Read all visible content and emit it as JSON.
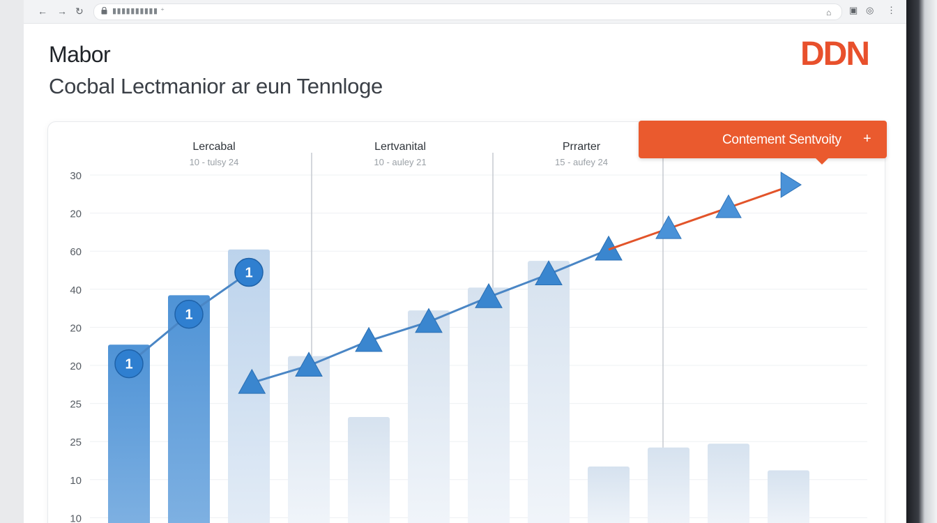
{
  "header": {
    "title": "Mabor",
    "subtitle": "Cocbal Lectmanior ar eun Tennloge",
    "brand": "DDN"
  },
  "tooltip": {
    "label": "Contement Sentvoity",
    "plus": "+"
  },
  "colors": {
    "brand": "#e8502c",
    "tooltip": "#ea5a2e",
    "bar_blue": "#5b9bd5",
    "bar_light": "#c8d8ea",
    "line_blue": "#4a86c5",
    "line_orange": "#e2542a"
  },
  "chart_data": {
    "type": "bar",
    "ytick_labels": [
      "30",
      "20",
      "60",
      "40",
      "20",
      "20",
      "25",
      "25",
      "10",
      "10"
    ],
    "column_headers": [
      {
        "label": "Lercabal",
        "sub": "10 - tulsy 24"
      },
      {
        "label": "Lertvanital",
        "sub": "10 - auley 21"
      },
      {
        "label": "Prrarter",
        "sub": "15 - aufey 24"
      }
    ],
    "bars": [
      {
        "level": 4.5,
        "tone": "dark"
      },
      {
        "level": 5.8,
        "tone": "dark"
      },
      {
        "level": 7.0,
        "tone": "light"
      },
      {
        "level": 4.2,
        "tone": "fade"
      },
      {
        "level": 2.6,
        "tone": "fade"
      },
      {
        "level": 5.4,
        "tone": "fade"
      },
      {
        "level": 6.0,
        "tone": "fade"
      },
      {
        "level": 6.7,
        "tone": "fade"
      },
      {
        "level": 1.3,
        "tone": "fade"
      },
      {
        "level": 1.8,
        "tone": "fade"
      },
      {
        "level": 1.9,
        "tone": "fade"
      },
      {
        "level": 1.2,
        "tone": "fade"
      }
    ],
    "circle_series": {
      "points": [
        [
          1,
          4.0
        ],
        [
          2,
          5.3
        ],
        [
          3,
          6.4
        ]
      ],
      "labels": [
        "1",
        "1",
        "1"
      ]
    },
    "triangle_series": {
      "points": [
        [
          3.05,
          3.5
        ],
        [
          4,
          3.95
        ],
        [
          5,
          4.6
        ],
        [
          6,
          5.1
        ],
        [
          7,
          5.75
        ],
        [
          8,
          6.35
        ],
        [
          9,
          7.0
        ]
      ]
    },
    "trend_series": {
      "points": [
        [
          9,
          7.0
        ],
        [
          10,
          7.55
        ],
        [
          11,
          8.1
        ],
        [
          12,
          8.65
        ]
      ]
    },
    "markers": {
      "triangles": [
        [
          10,
          7.55
        ],
        [
          11,
          8.1
        ],
        [
          12,
          8.7
        ]
      ]
    }
  }
}
